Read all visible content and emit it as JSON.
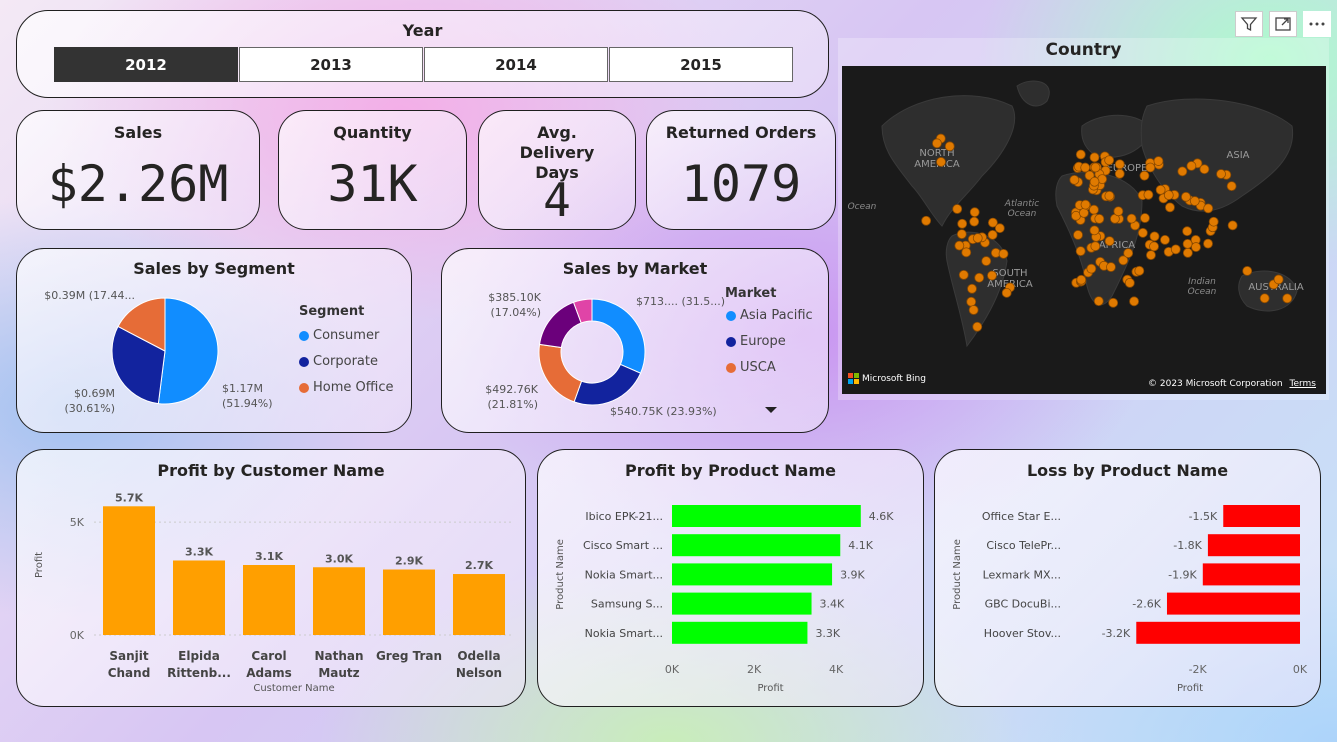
{
  "year_slicer": {
    "title": "Year",
    "options": [
      {
        "label": "2012",
        "selected": true
      },
      {
        "label": "2013",
        "selected": false
      },
      {
        "label": "2014",
        "selected": false
      },
      {
        "label": "2015",
        "selected": false
      }
    ]
  },
  "kpis": {
    "sales": {
      "title": "Sales",
      "value": "$2.26M"
    },
    "quantity": {
      "title": "Quantity",
      "value": "31K"
    },
    "delivery": {
      "title": "Avg. Delivery Days",
      "value": "4"
    },
    "returns": {
      "title": "Returned Orders",
      "value": "1079"
    }
  },
  "map": {
    "title": "Country",
    "continents": [
      "NORTH AMERICA",
      "SOUTH AMERICA",
      "EUROPE",
      "ASIA",
      "AFRICA",
      "AUSTRALIA"
    ],
    "oceans": [
      "Atlantic Ocean",
      "Indian Ocean",
      "Ocean"
    ],
    "attribution": "Microsoft Bing",
    "copyright": "© 2023 Microsoft Corporation",
    "terms": "Terms"
  },
  "toolbar": {
    "filter_icon": "filter-icon",
    "focus_icon": "focus-mode-icon",
    "more_icon": "more-options-icon"
  },
  "segment_chart": {
    "chart_data": {
      "type": "pie",
      "title": "Sales by Segment",
      "legend_title": "Segment",
      "slices": [
        {
          "name": "Consumer",
          "value": 1.17,
          "label": "$1.17M",
          "pct_label": "(51.94%)",
          "color": "#118DFF"
        },
        {
          "name": "Corporate",
          "value": 0.69,
          "label": "$0.69M",
          "pct_label": "(30.61%)",
          "color": "#12239E"
        },
        {
          "name": "Home Office",
          "value": 0.39,
          "label": "$0.39M (17.44...",
          "pct_label": "",
          "color": "#E66C37"
        }
      ]
    }
  },
  "market_chart": {
    "chart_data": {
      "type": "pie",
      "title": "Sales by Market",
      "legend_title": "Market",
      "legend": [
        "Asia Pacific",
        "Europe",
        "USCA"
      ],
      "slices": [
        {
          "name": "Asia Pacific",
          "value": 713,
          "label": "$713.... (31.5...)",
          "color": "#118DFF"
        },
        {
          "name": "Europe",
          "value": 540.75,
          "label": "$540.75K (23.93%)",
          "color": "#12239E"
        },
        {
          "name": "USCA",
          "value": 492.76,
          "label": "$492.76K",
          "pct_label": "(21.81%)",
          "color": "#E66C37"
        },
        {
          "name": "",
          "value": 385.1,
          "label": "$385.10K",
          "pct_label": "(17.04%)",
          "color": "#6B007B"
        },
        {
          "name": "",
          "value": 128,
          "label": "",
          "color": "#E044A7"
        }
      ]
    }
  },
  "customer_chart": {
    "chart_data": {
      "type": "bar",
      "title": "Profit by Customer Name",
      "xlabel": "Customer Name",
      "ylabel": "Profit",
      "ylim": [
        0,
        6200
      ],
      "ticks": [
        {
          "v": 0,
          "label": "0K"
        },
        {
          "v": 5000,
          "label": "5K"
        }
      ],
      "categories": [
        [
          "Sanjit",
          "Chand"
        ],
        [
          "Elpida",
          "Rittenb..."
        ],
        [
          "Carol",
          "Adams"
        ],
        [
          "Nathan",
          "Mautz"
        ],
        [
          "Greg Tran",
          ""
        ],
        [
          "Odella",
          "Nelson"
        ]
      ],
      "values": [
        5700,
        3300,
        3100,
        3000,
        2900,
        2700
      ],
      "labels": [
        "5.7K",
        "3.3K",
        "3.1K",
        "3.0K",
        "2.9K",
        "2.7K"
      ],
      "color": "#FF9F00"
    }
  },
  "product_chart": {
    "chart_data": {
      "type": "bar",
      "title": "Profit by Product Name",
      "xlabel": "Profit",
      "ylabel": "Product Name",
      "xlim": [
        0,
        4800
      ],
      "ticks": [
        {
          "v": 0,
          "label": "0K"
        },
        {
          "v": 2000,
          "label": "2K"
        },
        {
          "v": 4000,
          "label": "4K"
        }
      ],
      "categories": [
        "Ibico EPK-21...",
        "Cisco Smart ...",
        "Nokia Smart...",
        "Samsung S...",
        "Nokia Smart..."
      ],
      "values": [
        4600,
        4100,
        3900,
        3400,
        3300
      ],
      "labels": [
        "4.6K",
        "4.1K",
        "3.9K",
        "3.4K",
        "3.3K"
      ],
      "color": "#00FF00"
    }
  },
  "loss_chart": {
    "chart_data": {
      "type": "bar",
      "title": "Loss by Product Name",
      "xlabel": "Profit",
      "ylabel": "Product Name",
      "xlim": [
        -4300,
        0
      ],
      "ticks": [
        {
          "v": -2000,
          "label": "-2K"
        },
        {
          "v": 0,
          "label": "0K"
        }
      ],
      "categories": [
        "Office Star E...",
        "Cisco TelePr...",
        "Lexmark MX...",
        "GBC DocuBi...",
        "Hoover Stov..."
      ],
      "values": [
        -1500,
        -1800,
        -1900,
        -2600,
        -3200
      ],
      "labels": [
        "-1.5K",
        "-1.8K",
        "-1.9K",
        "-2.6K",
        "-3.2K"
      ],
      "color": "#FF0000"
    }
  }
}
